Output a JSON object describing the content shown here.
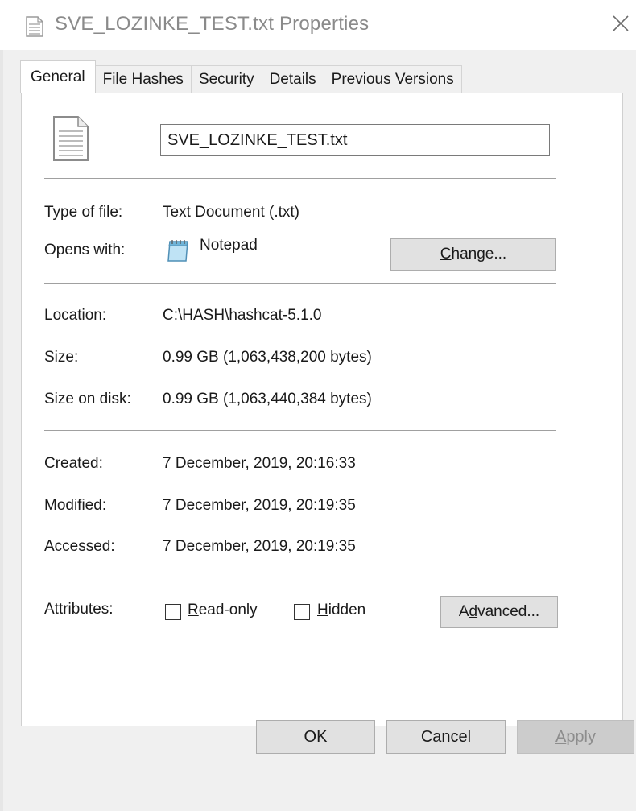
{
  "window": {
    "title": "SVE_LOZINKE_TEST.txt Properties",
    "icons": {
      "title": "document-icon",
      "close": "close-icon"
    }
  },
  "tabs": [
    {
      "label": "General",
      "active": true
    },
    {
      "label": "File Hashes",
      "active": false
    },
    {
      "label": "Security",
      "active": false
    },
    {
      "label": "Details",
      "active": false
    },
    {
      "label": "Previous Versions",
      "active": false
    }
  ],
  "general": {
    "file_name": "SVE_LOZINKE_TEST.txt",
    "type_label": "Type of file:",
    "type_value": "Text Document (.txt)",
    "opens_label": "Opens with:",
    "opens_value": "Notepad",
    "change_button": {
      "pre": "",
      "key": "C",
      "post": "hange..."
    },
    "location_label": "Location:",
    "location_value": "C:\\HASH\\hashcat-5.1.0",
    "size_label": "Size:",
    "size_value": "0.99 GB (1,063,438,200 bytes)",
    "size_on_disk_label": "Size on disk:",
    "size_on_disk_value": "0.99 GB (1,063,440,384 bytes)",
    "created_label": "Created:",
    "created_value": "7 December, 2019, 20:16:33",
    "modified_label": "Modified:",
    "modified_value": "7 December, 2019, 20:19:35",
    "accessed_label": "Accessed:",
    "accessed_value": "7 December, 2019, 20:19:35",
    "attributes_label": "Attributes:",
    "readonly": {
      "pre": "",
      "key": "R",
      "post": "ead-only",
      "checked": false
    },
    "hidden": {
      "pre": "",
      "key": "H",
      "post": "idden",
      "checked": false
    },
    "advanced_button": {
      "pre": "A",
      "key": "d",
      "post": "vanced..."
    }
  },
  "footer": {
    "ok_label": "OK",
    "cancel_label": "Cancel",
    "apply": {
      "pre": "",
      "key": "A",
      "post": "pply",
      "disabled": true
    }
  },
  "colors": {
    "title_text": "#8a8a8a",
    "client_bg": "#f0f0f0",
    "button_bg": "#e1e1e1",
    "disabled_text": "#8d8d8d"
  }
}
